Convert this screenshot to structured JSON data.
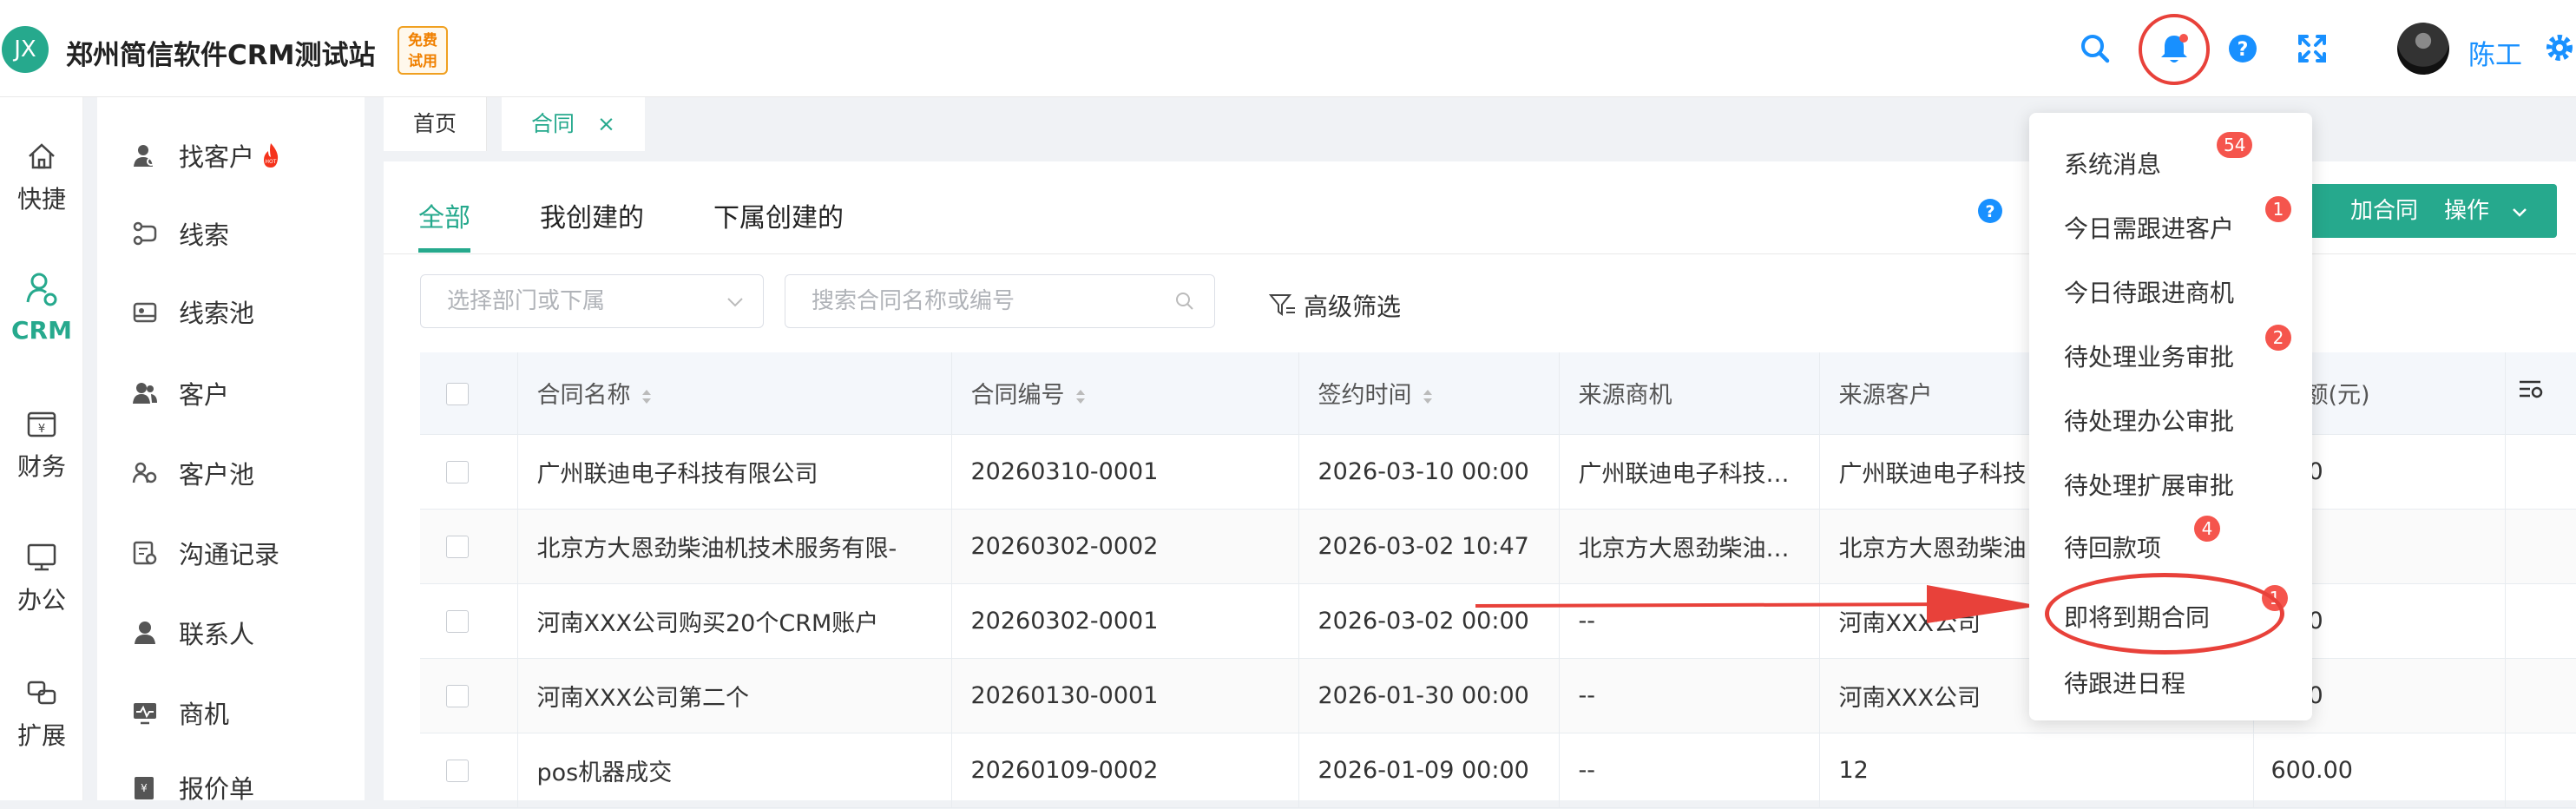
{
  "header": {
    "logo_text": "JX",
    "site_title": "郑州简信软件CRM测试站",
    "free_badge_line1": "免费",
    "free_badge_line2": "试用",
    "user_name": "陈工",
    "icons": [
      "search-icon",
      "bell-icon",
      "help-icon",
      "fullscreen-icon",
      "settings-icon"
    ],
    "accent_color": "#26a98d",
    "link_color": "#1890ff",
    "alert_color": "#e8413a"
  },
  "nav_primary": [
    {
      "label": "快捷",
      "icon": "home-icon"
    },
    {
      "label": "CRM",
      "icon": "crm-icon",
      "active": true
    },
    {
      "label": "财务",
      "icon": "finance-icon"
    },
    {
      "label": "办公",
      "icon": "office-icon"
    },
    {
      "label": "扩展",
      "icon": "extend-icon"
    }
  ],
  "nav_secondary": [
    {
      "label": "找客户",
      "icon": "find-customer-icon",
      "hot_icon": "flame-icon"
    },
    {
      "label": "线索",
      "icon": "lead-icon"
    },
    {
      "label": "线索池",
      "icon": "lead-pool-icon"
    },
    {
      "label": "客户",
      "icon": "customer-icon"
    },
    {
      "label": "客户池",
      "icon": "customer-pool-icon"
    },
    {
      "label": "沟通记录",
      "icon": "communication-icon"
    },
    {
      "label": "联系人",
      "icon": "contact-icon"
    },
    {
      "label": "商机",
      "icon": "opportunity-icon"
    },
    {
      "label": "报价单",
      "icon": "quote-icon"
    }
  ],
  "tabs": {
    "home": "首页",
    "active": "合同",
    "close_glyph": "×"
  },
  "sub_tabs": [
    "全部",
    "我创建的",
    "下属创建的"
  ],
  "filters": {
    "dept_placeholder": "选择部门或下属",
    "search_placeholder": "搜索合同名称或编号",
    "advanced_filter": "高级筛选"
  },
  "actions": {
    "add_contract": "加合同",
    "operate": "操作"
  },
  "table": {
    "columns": [
      "合同名称",
      "合同编号",
      "签约时间",
      "来源商机",
      "来源客户",
      "金额(元)"
    ],
    "rows": [
      {
        "name": "广州联迪电子科技有限公司",
        "code": "20260310-0001",
        "date": "2026-03-10 00:00",
        "opportunity": "广州联迪电子科技…",
        "customer": "广州联迪电子科技",
        "amount": "0.00"
      },
      {
        "name": "北京方大恩劲柴油机技术服务有限-",
        "code": "20260302-0002",
        "date": "2026-03-02 10:47",
        "opportunity": "北京方大恩劲柴油…",
        "customer": "北京方大恩劲柴油",
        "amount": "00"
      },
      {
        "name": "河南XXX公司购买20个CRM账户",
        "code": "20260302-0001",
        "date": "2026-03-02 00:00",
        "opportunity": "--",
        "customer": "河南XXX公司",
        "amount": "0.00"
      },
      {
        "name": "河南XXX公司第二个",
        "code": "20260130-0001",
        "date": "2026-01-30 00:00",
        "opportunity": "--",
        "customer": "河南XXX公司",
        "amount": "0.00"
      },
      {
        "name": "pos机器成交",
        "code": "20260109-0002",
        "date": "2026-01-09 00:00",
        "opportunity": "--",
        "customer": "12",
        "amount": "600.00"
      }
    ]
  },
  "notifications": [
    {
      "label": "系统消息",
      "badge": "54"
    },
    {
      "label": "今日需跟进客户",
      "badge": "1"
    },
    {
      "label": "今日待跟进商机",
      "badge": ""
    },
    {
      "label": "待处理业务审批",
      "badge": "2"
    },
    {
      "label": "待处理办公审批",
      "badge": ""
    },
    {
      "label": "待处理扩展审批",
      "badge": ""
    },
    {
      "label": "待回款项",
      "badge": "4"
    },
    {
      "label": "即将到期合同",
      "badge": "1",
      "highlighted": true
    },
    {
      "label": "待跟进日程",
      "badge": ""
    }
  ]
}
